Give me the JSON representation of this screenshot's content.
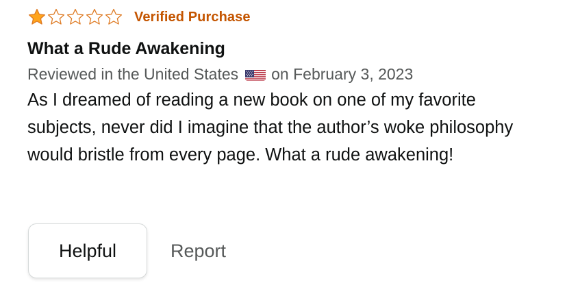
{
  "review": {
    "rating": 1,
    "rating_max": 5,
    "star_color": "#ffa41c",
    "star_outline_color": "#de7921",
    "verified_label": "Verified Purchase",
    "verified_color": "#c45500",
    "title": "What a Rude Awakening",
    "reviewed_prefix": "Reviewed in the United States",
    "flag_icon": "us-flag-icon",
    "reviewed_date": "on February 3, 2023",
    "body": "As I dreamed of reading a new book on one of my favorite subjects, never did I imagine that the author’s woke philosophy would bristle from every page. What a rude awakening!"
  },
  "actions": {
    "helpful_label": "Helpful",
    "report_label": "Report"
  }
}
